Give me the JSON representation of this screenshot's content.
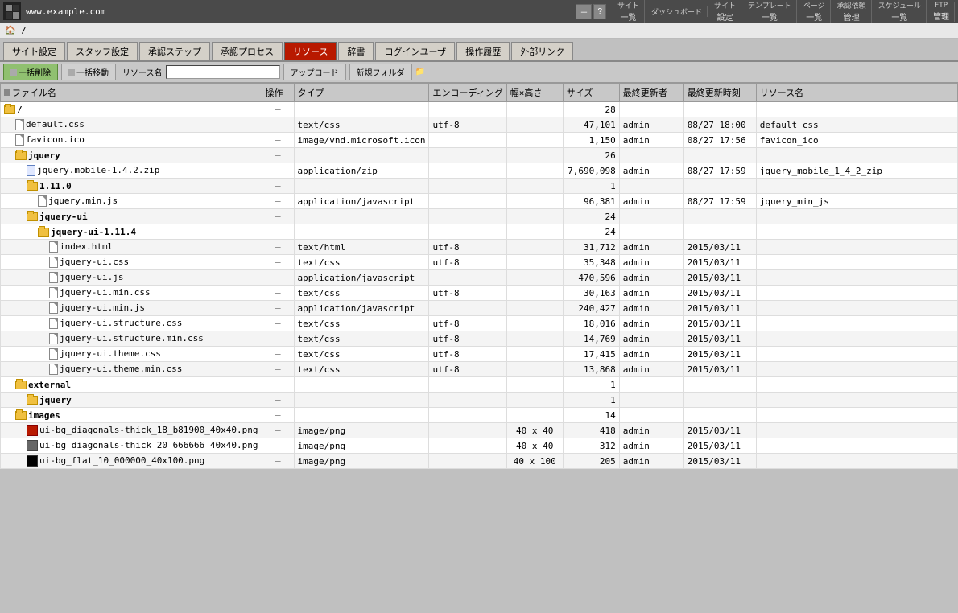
{
  "topbar": {
    "url": "www.example.com",
    "controls": [
      "－",
      "?"
    ]
  },
  "nav": [
    {
      "top": "サイト",
      "bottom": "一覧"
    },
    {
      "top": "ダッシュボード",
      "bottom": ""
    },
    {
      "top": "サイト",
      "bottom": "設定"
    },
    {
      "top": "テンプレート",
      "bottom": "一覧"
    },
    {
      "top": "ページ",
      "bottom": "一覧"
    },
    {
      "top": "承認依頼",
      "bottom": "管理"
    },
    {
      "top": "スケジュール",
      "bottom": "一覧"
    },
    {
      "top": "FTP",
      "bottom": "管理"
    }
  ],
  "breadcrumb": "/",
  "tabs": [
    {
      "label": "サイト設定",
      "active": false
    },
    {
      "label": "スタッフ設定",
      "active": false
    },
    {
      "label": "承認ステップ",
      "active": false
    },
    {
      "label": "承認プロセス",
      "active": false
    },
    {
      "label": "リソース",
      "active": true
    },
    {
      "label": "辞書",
      "active": false
    },
    {
      "label": "ログインユーザ",
      "active": false
    },
    {
      "label": "操作履歴",
      "active": false
    },
    {
      "label": "外部リンク",
      "active": false
    }
  ],
  "action_bar": {
    "delete_all": "一括削除",
    "move_all": "一括移動",
    "resource_name_label": "リソース名",
    "resource_name_placeholder": "",
    "upload_label": "アップロード",
    "new_folder_label": "新規フォルダ"
  },
  "table_headers": [
    "ファイル名",
    "操作",
    "タイプ",
    "エンコーディング",
    "幅×高さ",
    "サイズ",
    "最終更新者",
    "最終更新時刻",
    "リソース名"
  ],
  "files": [
    {
      "indent": 0,
      "type": "folder-open",
      "name": "/",
      "op": "—",
      "mime": "",
      "enc": "",
      "dim": "",
      "size": "28",
      "updater": "",
      "updated": "",
      "resname": ""
    },
    {
      "indent": 1,
      "type": "file",
      "name": "default.css",
      "op": "—",
      "mime": "text/css",
      "enc": "utf-8",
      "dim": "",
      "size": "47,101",
      "updater": "admin",
      "updated": "08/27 18:00",
      "resname": "default_css"
    },
    {
      "indent": 1,
      "type": "file",
      "name": "favicon.ico",
      "op": "—",
      "mime": "image/vnd.microsoft.icon",
      "enc": "",
      "dim": "",
      "size": "1,150",
      "updater": "admin",
      "updated": "08/27 17:56",
      "resname": "favicon_ico"
    },
    {
      "indent": 1,
      "type": "folder",
      "name": "jquery",
      "op": "—",
      "mime": "",
      "enc": "",
      "dim": "",
      "size": "26",
      "updater": "",
      "updated": "",
      "resname": ""
    },
    {
      "indent": 2,
      "type": "zip",
      "name": "jquery.mobile-1.4.2.zip",
      "op": "—",
      "mime": "application/zip",
      "enc": "",
      "dim": "",
      "size": "7,690,098",
      "updater": "admin",
      "updated": "08/27 17:59",
      "resname": "jquery_mobile_1_4_2_zip"
    },
    {
      "indent": 2,
      "type": "folder",
      "name": "1.11.0",
      "op": "—",
      "mime": "",
      "enc": "",
      "dim": "",
      "size": "1",
      "updater": "",
      "updated": "",
      "resname": ""
    },
    {
      "indent": 3,
      "type": "file",
      "name": "jquery.min.js",
      "op": "—",
      "mime": "application/javascript",
      "enc": "",
      "dim": "",
      "size": "96,381",
      "updater": "admin",
      "updated": "08/27 17:59",
      "resname": "jquery_min_js"
    },
    {
      "indent": 2,
      "type": "folder",
      "name": "jquery-ui",
      "op": "—",
      "mime": "",
      "enc": "",
      "dim": "",
      "size": "24",
      "updater": "",
      "updated": "",
      "resname": ""
    },
    {
      "indent": 3,
      "type": "folder",
      "name": "jquery-ui-1.11.4",
      "op": "—",
      "mime": "",
      "enc": "",
      "dim": "",
      "size": "24",
      "updater": "",
      "updated": "",
      "resname": ""
    },
    {
      "indent": 4,
      "type": "file",
      "name": "index.html",
      "op": "—",
      "mime": "text/html",
      "enc": "utf-8",
      "dim": "",
      "size": "31,712",
      "updater": "admin",
      "updated": "2015/03/11",
      "resname": ""
    },
    {
      "indent": 4,
      "type": "file",
      "name": "jquery-ui.css",
      "op": "—",
      "mime": "text/css",
      "enc": "utf-8",
      "dim": "",
      "size": "35,348",
      "updater": "admin",
      "updated": "2015/03/11",
      "resname": ""
    },
    {
      "indent": 4,
      "type": "file",
      "name": "jquery-ui.js",
      "op": "—",
      "mime": "application/javascript",
      "enc": "",
      "dim": "",
      "size": "470,596",
      "updater": "admin",
      "updated": "2015/03/11",
      "resname": ""
    },
    {
      "indent": 4,
      "type": "file",
      "name": "jquery-ui.min.css",
      "op": "—",
      "mime": "text/css",
      "enc": "utf-8",
      "dim": "",
      "size": "30,163",
      "updater": "admin",
      "updated": "2015/03/11",
      "resname": ""
    },
    {
      "indent": 4,
      "type": "file",
      "name": "jquery-ui.min.js",
      "op": "—",
      "mime": "application/javascript",
      "enc": "",
      "dim": "",
      "size": "240,427",
      "updater": "admin",
      "updated": "2015/03/11",
      "resname": ""
    },
    {
      "indent": 4,
      "type": "file",
      "name": "jquery-ui.structure.css",
      "op": "—",
      "mime": "text/css",
      "enc": "utf-8",
      "dim": "",
      "size": "18,016",
      "updater": "admin",
      "updated": "2015/03/11",
      "resname": ""
    },
    {
      "indent": 4,
      "type": "file",
      "name": "jquery-ui.structure.min.css",
      "op": "—",
      "mime": "text/css",
      "enc": "utf-8",
      "dim": "",
      "size": "14,769",
      "updater": "admin",
      "updated": "2015/03/11",
      "resname": ""
    },
    {
      "indent": 4,
      "type": "file",
      "name": "jquery-ui.theme.css",
      "op": "—",
      "mime": "text/css",
      "enc": "utf-8",
      "dim": "",
      "size": "17,415",
      "updater": "admin",
      "updated": "2015/03/11",
      "resname": ""
    },
    {
      "indent": 4,
      "type": "file",
      "name": "jquery-ui.theme.min.css",
      "op": "—",
      "mime": "text/css",
      "enc": "utf-8",
      "dim": "",
      "size": "13,868",
      "updater": "admin",
      "updated": "2015/03/11",
      "resname": ""
    },
    {
      "indent": 1,
      "type": "folder",
      "name": "external",
      "op": "—",
      "mime": "",
      "enc": "",
      "dim": "",
      "size": "1",
      "updater": "",
      "updated": "",
      "resname": ""
    },
    {
      "indent": 2,
      "type": "folder",
      "name": "jquery",
      "op": "—",
      "mime": "",
      "enc": "",
      "dim": "",
      "size": "1",
      "updater": "",
      "updated": "",
      "resname": ""
    },
    {
      "indent": 1,
      "type": "folder",
      "name": "images",
      "op": "—",
      "mime": "",
      "enc": "",
      "dim": "",
      "size": "14",
      "updater": "",
      "updated": "",
      "resname": ""
    },
    {
      "indent": 2,
      "type": "img-red",
      "name": "ui-bg_diagonals-thick_18_b81900_40x40.png",
      "op": "—",
      "mime": "image/png",
      "enc": "",
      "dim": "40 x 40",
      "size": "418",
      "updater": "admin",
      "updated": "2015/03/11",
      "resname": ""
    },
    {
      "indent": 2,
      "type": "img-gray",
      "name": "ui-bg_diagonals-thick_20_666666_40x40.png",
      "op": "—",
      "mime": "image/png",
      "enc": "",
      "dim": "40 x 40",
      "size": "312",
      "updater": "admin",
      "updated": "2015/03/11",
      "resname": ""
    },
    {
      "indent": 2,
      "type": "img-black",
      "name": "ui-bg_flat_10_000000_40x100.png",
      "op": "—",
      "mime": "image/png",
      "enc": "",
      "dim": "40 x 100",
      "size": "205",
      "updater": "admin",
      "updated": "2015/03/11",
      "resname": ""
    }
  ]
}
